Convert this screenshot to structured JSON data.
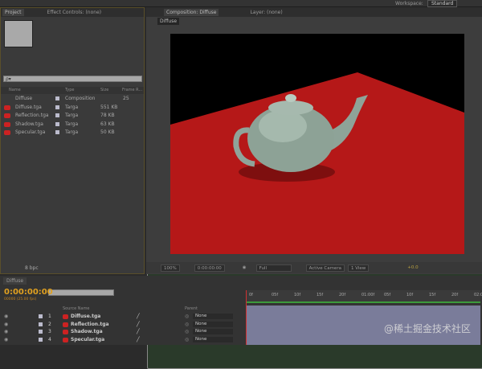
{
  "top": {
    "workspace_label": "Workspace:",
    "workspace_value": "Standard"
  },
  "project": {
    "tab": "Project",
    "tab_effects": "Effect Controls: (none)",
    "search_placeholder": "ρ▾",
    "bpc": "8 bpc",
    "columns": [
      "Name",
      "Type",
      "Size",
      "Frame R..."
    ],
    "items": [
      {
        "name": "Diffuse",
        "type": "Composition",
        "size": "",
        "frame": "25",
        "kind": "comp"
      },
      {
        "name": "Diffuse.tga",
        "type": "Targa",
        "size": "551 KB",
        "frame": "",
        "kind": "tga"
      },
      {
        "name": "Reflection.tga",
        "type": "Targa",
        "size": "78 KB",
        "frame": "",
        "kind": "tga"
      },
      {
        "name": "Shadow.tga",
        "type": "Targa",
        "size": "63 KB",
        "frame": "",
        "kind": "tga"
      },
      {
        "name": "Specular.tga",
        "type": "Targa",
        "size": "50 KB",
        "frame": "",
        "kind": "tga"
      }
    ]
  },
  "composition": {
    "tab": "Composition: Diffuse",
    "layer_tab": "Layer: (none)",
    "sub_tab": "Diffuse",
    "toolbar": {
      "zoom": "100%",
      "timecode": "0:00:00:00",
      "resolution": "Full",
      "camera": "Active Camera",
      "views": "1 View",
      "exposure": "+0.0"
    }
  },
  "timeline": {
    "tab": "Diffuse",
    "timecode": "0:00:00:00",
    "frames": "00000 (25.00 fps)",
    "source_name_header": "Source Name",
    "parent_header": "Parent",
    "layers": [
      {
        "num": "1",
        "name": "Diffuse.tga",
        "parent": "None"
      },
      {
        "num": "2",
        "name": "Reflection.tga",
        "parent": "None"
      },
      {
        "num": "3",
        "name": "Shadow.tga",
        "parent": "None"
      },
      {
        "num": "4",
        "name": "Specular.tga",
        "parent": "None"
      }
    ],
    "ruler": [
      "0f",
      "05f",
      "10f",
      "15f",
      "20f",
      "01:00f",
      "05f",
      "10f",
      "15f",
      "20f",
      "02:0"
    ]
  },
  "watermark": "@稀土掘金技术社区"
}
